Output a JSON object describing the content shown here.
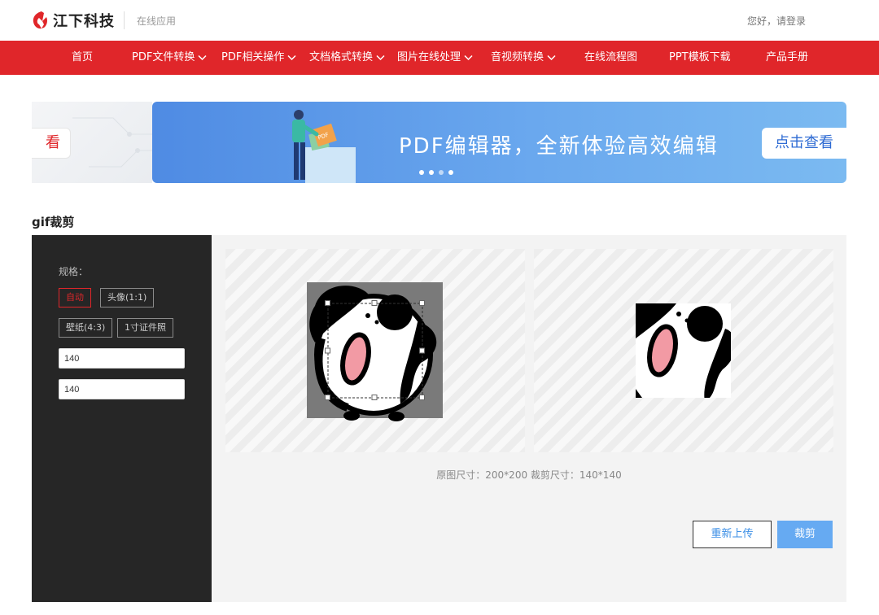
{
  "header": {
    "logo_text": "江下科技",
    "logo_sub": "在线应用",
    "login": "您好，请登录"
  },
  "nav": {
    "items": [
      {
        "label": "首页"
      },
      {
        "label": "PDF文件转换"
      },
      {
        "label": "PDF相关操作"
      },
      {
        "label": "文档格式转换"
      },
      {
        "label": "图片在线处理"
      },
      {
        "label": "音视频转换"
      },
      {
        "label": "在线流程图"
      },
      {
        "label": "PPT模板下载"
      },
      {
        "label": "产品手册"
      }
    ]
  },
  "banner": {
    "left_cta": "看",
    "title": "PDF编辑器，全新体验高效编辑",
    "cta": "点击查看",
    "art_label": "PDF"
  },
  "tool": {
    "title": "gif裁剪",
    "spec_label": "规格：",
    "specs": [
      {
        "label": "自动"
      },
      {
        "label": "头像(1:1)"
      },
      {
        "label": "壁纸(4:3)"
      },
      {
        "label": "1寸证件照"
      }
    ],
    "width_value": "140",
    "height_value": "140",
    "info": "原图尺寸：200*200 裁剪尺寸：140*140",
    "reupload_label": "重新上传",
    "crop_label": "裁剪"
  },
  "colors": {
    "brand_red": "#e0262a",
    "crop_blue": "#66aaf2",
    "sidebar": "#262626"
  }
}
